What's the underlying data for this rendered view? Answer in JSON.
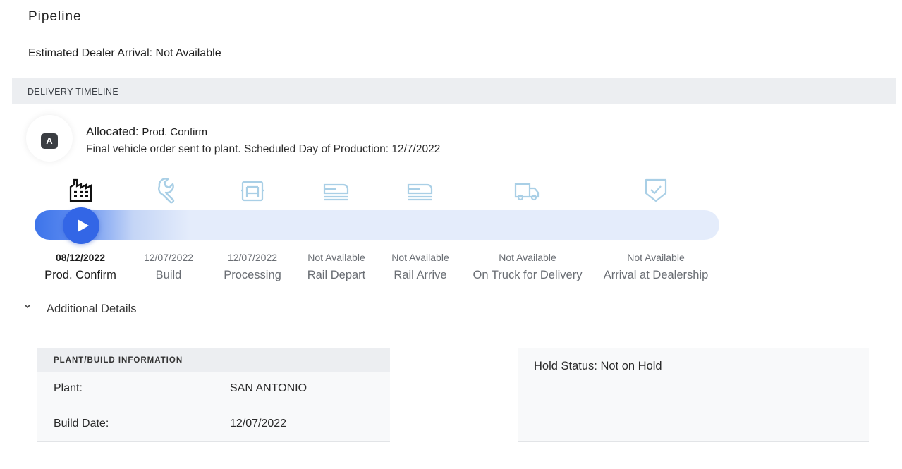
{
  "page": {
    "title": "Pipeline",
    "estimated_arrival": "Estimated Dealer Arrival: Not Available"
  },
  "timeline": {
    "header": "DELIVERY TIMELINE",
    "status": {
      "badge": "A",
      "label": "Allocated:",
      "stage": "Prod. Confirm",
      "description": "Final vehicle order sent to plant. Scheduled Day of Production: 12/7/2022"
    },
    "stages": [
      {
        "date": "08/12/2022",
        "label": "Prod. Confirm",
        "icon": "factory-icon",
        "active": true
      },
      {
        "date": "12/07/2022",
        "label": "Build",
        "icon": "wrench-icon",
        "active": false
      },
      {
        "date": "12/07/2022",
        "label": "Processing",
        "icon": "processing-icon",
        "active": false
      },
      {
        "date": "Not Available",
        "label": "Rail Depart",
        "icon": "rail-car-icon",
        "active": false
      },
      {
        "date": "Not Available",
        "label": "Rail Arrive",
        "icon": "rail-car-icon",
        "active": false
      },
      {
        "date": "Not Available",
        "label": "On Truck for Delivery",
        "icon": "truck-icon",
        "active": false
      },
      {
        "date": "Not Available",
        "label": "Arrival at Dealership",
        "icon": "shield-check-icon",
        "active": false
      }
    ],
    "colors": {
      "accent": "#3366e6",
      "inactive_icon": "#a9cfe6",
      "track": "#e4ecfb"
    }
  },
  "details": {
    "toggle_icon": "chevron-down-icon",
    "label": "Additional Details",
    "plant_card": {
      "header": "PLANT/BUILD INFORMATION",
      "rows": [
        {
          "label": "Plant:",
          "value": "SAN ANTONIO"
        },
        {
          "label": "Build Date:",
          "value": "12/07/2022"
        }
      ]
    },
    "hold_status": "Hold Status: Not on Hold"
  }
}
